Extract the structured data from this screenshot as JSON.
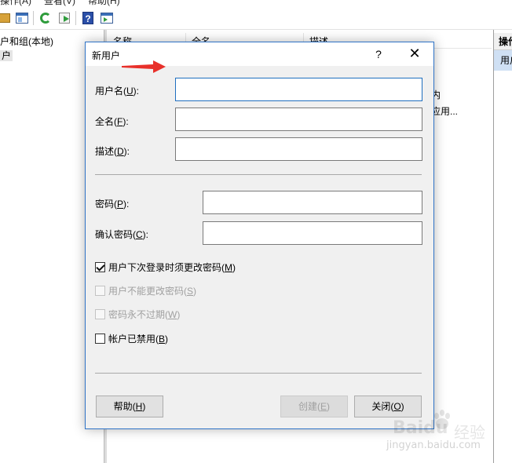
{
  "menu": {
    "items": [
      "操作(A)",
      "查看(V)",
      "帮助(H)"
    ]
  },
  "toolbar": {
    "icons": [
      "back-icon",
      "show-hide-tree-icon",
      "refresh-icon",
      "export-list-icon",
      "help-icon",
      "show-hide-action-pane-icon"
    ]
  },
  "tree": {
    "root_label": "户和组(本地)",
    "selected_label": "户"
  },
  "list": {
    "columns": [
      "名称",
      "全名",
      "描述"
    ],
    "partial_cells": [
      "内",
      "应用..."
    ]
  },
  "actions_pane": {
    "title": "操作",
    "item": "用户"
  },
  "dialog": {
    "title": "新用户",
    "help_glyph": "?",
    "close_glyph": "✕",
    "fields": {
      "username": {
        "label": "用户名(",
        "key": "U",
        "suffix": "):",
        "value": ""
      },
      "fullname": {
        "label": "全名(",
        "key": "F",
        "suffix": "):",
        "value": ""
      },
      "description": {
        "label": "描述(",
        "key": "D",
        "suffix": "):",
        "value": ""
      },
      "password": {
        "label": "密码(",
        "key": "P",
        "suffix": "):",
        "value": ""
      },
      "confirm": {
        "label": "确认密码(",
        "key": "C",
        "suffix": "):",
        "value": ""
      }
    },
    "checkboxes": {
      "must_change": {
        "label": "用户下次登录时须更改密码(",
        "key": "M",
        "suffix": ")",
        "checked": true,
        "enabled": true
      },
      "cannot_change": {
        "label": "用户不能更改密码(",
        "key": "S",
        "suffix": ")",
        "checked": false,
        "enabled": false
      },
      "never_expires": {
        "label": "密码永不过期(",
        "key": "W",
        "suffix": ")",
        "checked": false,
        "enabled": false
      },
      "disabled": {
        "label": "帐户已禁用(",
        "key": "B",
        "suffix": ")",
        "checked": false,
        "enabled": true
      }
    },
    "buttons": {
      "help": {
        "label": "帮助(",
        "key": "H",
        "suffix": ")"
      },
      "create": {
        "label": "创建(",
        "key": "E",
        "suffix": ")"
      },
      "close": {
        "label": "关闭(",
        "key": "O",
        "suffix": ")"
      }
    }
  },
  "watermark": {
    "brand": "Baidu",
    "brand_cn": "经验",
    "url": "jingyan.baidu.com"
  },
  "colors": {
    "dialog_border": "#2f73c6",
    "focus_border": "#1f6fbf",
    "arrow_red": "#e8302a",
    "selection": "#cfe0f4"
  }
}
